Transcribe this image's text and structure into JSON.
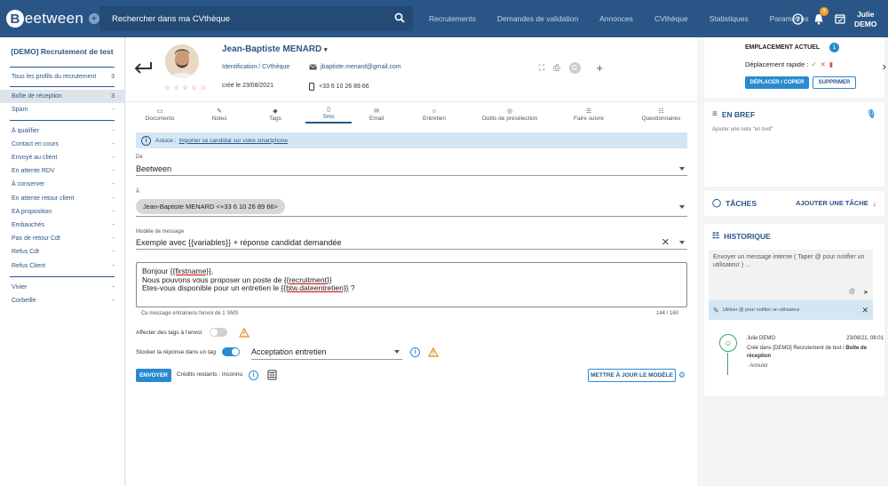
{
  "app": {
    "logo_text": "eetween",
    "logo_letter": "B"
  },
  "header": {
    "search_placeholder": "Rechercher dans ma CVthèque",
    "nav": [
      "Recrutements",
      "Demandes de validation",
      "Annonces",
      "CVthèque",
      "Statistiques",
      "Paramètres"
    ],
    "notif_count": "3",
    "user_first": "Julie",
    "user_last": "DEMO"
  },
  "sidebar": {
    "title": "[DEMO] Recrutement de test",
    "items": [
      {
        "label": "Tous les profils du recrutement",
        "count": "3"
      },
      {
        "label": "Boîte de réception",
        "count": "3"
      },
      {
        "label": "Spam",
        "count": "-"
      },
      {
        "label": "À qualifier",
        "count": "-"
      },
      {
        "label": "Contact en cours",
        "count": "-"
      },
      {
        "label": "Envoyé au client",
        "count": "-"
      },
      {
        "label": "En attente RDV",
        "count": "-"
      },
      {
        "label": "À conserver",
        "count": "-"
      },
      {
        "label": "En attente retour client",
        "count": "-"
      },
      {
        "label": "EA proposition",
        "count": "-"
      },
      {
        "label": "Embauchés",
        "count": "-"
      },
      {
        "label": "Pas de retour Cdt",
        "count": "-"
      },
      {
        "label": "Refus Cdt",
        "count": "-"
      },
      {
        "label": "Refus Client",
        "count": "-"
      },
      {
        "label": "Vivier",
        "count": "-"
      },
      {
        "label": "Corbeille",
        "count": "-"
      }
    ]
  },
  "candidate": {
    "name": "Jean-Baptiste MENARD",
    "identification": "Identification / CVthèque",
    "created": "créé le 23/08/2021",
    "email": "jbaptiste.menard@gmail.com",
    "phone": "+33 6 10 26 89 66",
    "stars": "☆ ☆ ☆ ☆ ☆",
    "g_letter": "G"
  },
  "placement": {
    "title": "EMPLACEMENT ACTUEL",
    "count": "1",
    "quick_move": "Déplacement rapide :",
    "move_button": "DÉPLACER / COPIER",
    "delete_button": "SUPPRIMER"
  },
  "tabs": [
    "Documents",
    "Notes",
    "Tags",
    "Sms",
    "Email",
    "Entretien",
    "Outils de présélection",
    "Faire suivre",
    "Questionnaires"
  ],
  "sms": {
    "tip_prefix": "Astuce :",
    "tip_link": "Importer ce candidat sur votre smartphone",
    "from_label": "De",
    "from_value": "Beetween",
    "to_label": "À",
    "to_chip": "Jean-Baptiste MENARD <+33 6 10 26 89 66>",
    "template_label": "Modèle de message",
    "template_value": "Exemple avec {{variables}} + réponse candidat demandée",
    "line1_a": "Bonjour ",
    "line1_var": "{{firstname}}",
    "line1_b": ",",
    "line2_a": "Nous pouvons vous proposer un poste de ",
    "line2_var": "{{recruitment}}",
    "line3_a": "Etes-vous disponible pour un entretien le ",
    "line3_var": "{{btw.dateentretien}}",
    "line3_b": " ?",
    "cost_note": "Ce message entraînera l'envoi de 1 SMS",
    "char_count": "144 / 160",
    "assign_tags_label": "Affecter des tags à l'envoi",
    "store_reply_label": "Stocker la réponse dans un tag",
    "store_tag_value": "Acceptation entretien",
    "send_button": "ENVOYER",
    "credits": "Crédits restants : Inconnu",
    "update_template_button": "METTRE À JOUR LE MODÈLE"
  },
  "right": {
    "brief_title": "EN BREF",
    "brief_placeholder": "Ajouter une note \"en bref\"",
    "tasks_title": "TÂCHES",
    "add_task": "AJOUTER UNE TÂCHE",
    "history_title": "HISTORIQUE",
    "msg_placeholder": "Envoyer un message interne ( Taper @ pour notifier un utilisateur ) ...",
    "mention_hint": "Utiliser @ pour notifier un utilisateur",
    "entry_author": "Julie DEMO",
    "entry_date": "23/08/21, 08:01",
    "entry_text_a": "Créé dans [DEMO] Recrutement de test / ",
    "entry_text_b": "Boîte de réception",
    "entry_cancel": "· Annuler"
  }
}
